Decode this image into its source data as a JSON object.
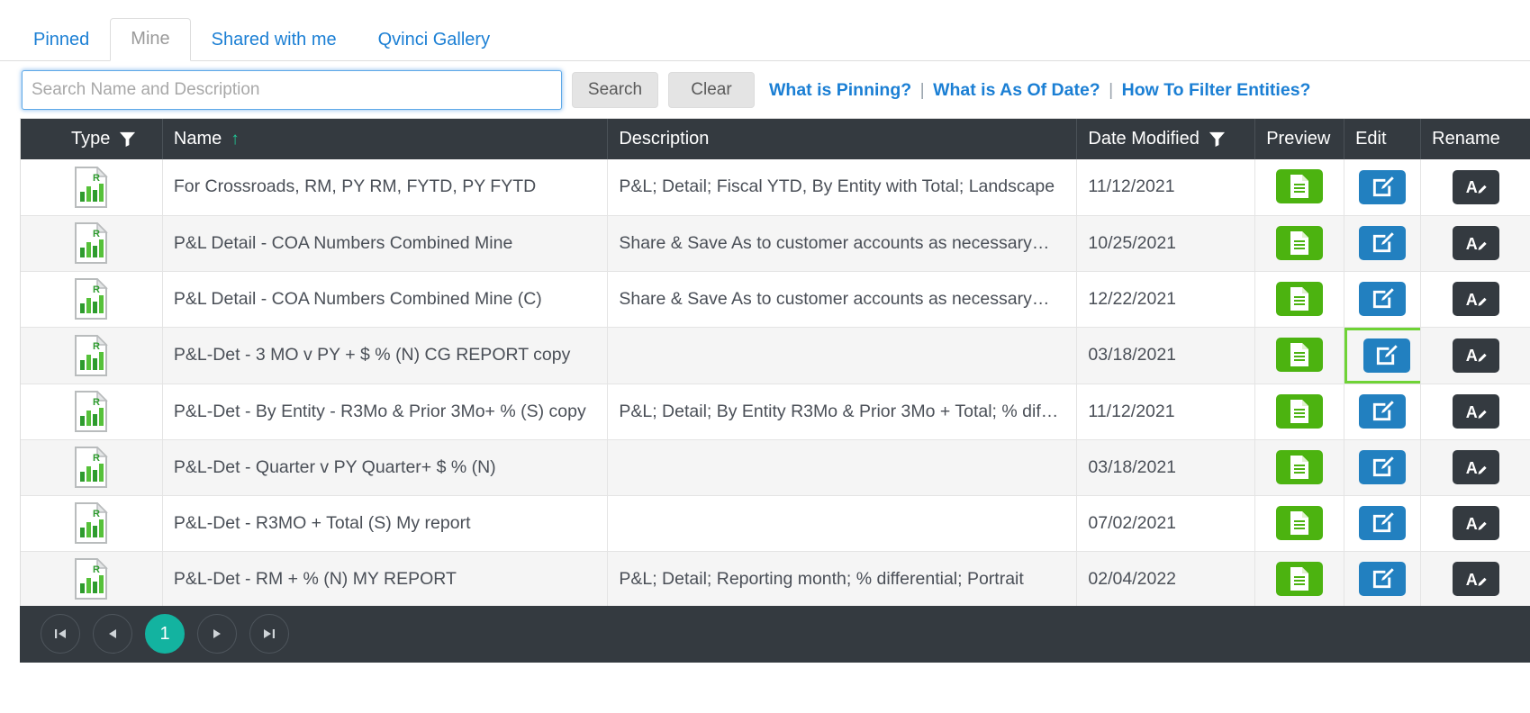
{
  "tabs": [
    {
      "label": "Pinned",
      "active": false
    },
    {
      "label": "Mine",
      "active": true
    },
    {
      "label": "Shared with me",
      "active": false
    },
    {
      "label": "Qvinci Gallery",
      "active": false
    }
  ],
  "search": {
    "value": "",
    "placeholder": "Search Name and Description",
    "search_button": "Search",
    "clear_button": "Clear"
  },
  "help_links": [
    {
      "label": "What is Pinning?"
    },
    {
      "label": "What is As Of Date?"
    },
    {
      "label": "How To Filter Entities?"
    }
  ],
  "link_separator": "|",
  "grid": {
    "columns": {
      "type": "Type",
      "name": "Name",
      "description": "Description",
      "date_modified": "Date Modified",
      "preview": "Preview",
      "edit": "Edit",
      "rename": "Rename"
    },
    "sort": {
      "column": "Name",
      "direction": "ascending",
      "glyph": "↑"
    },
    "filters": [
      "type-filter-icon",
      "date-modified-filter-icon"
    ],
    "rows": [
      {
        "type_icon": "report-chart-document-icon",
        "name": "For Crossroads, RM, PY RM, FYTD, PY FYTD",
        "description": "P&L; Detail; Fiscal YTD, By Entity with Total; Landscape",
        "date_modified": "11/12/2021",
        "preview_icon": "preview-document-icon",
        "edit_icon": "edit-pencil-icon",
        "rename_icon": "rename-a-pencil-icon",
        "edit_focused": false
      },
      {
        "type_icon": "report-chart-document-icon",
        "name": "P&L Detail - COA Numbers Combined Mine",
        "description": "Share & Save As to customer accounts as necessary…",
        "date_modified": "10/25/2021",
        "preview_icon": "preview-document-icon",
        "edit_icon": "edit-pencil-icon",
        "rename_icon": "rename-a-pencil-icon",
        "edit_focused": false
      },
      {
        "type_icon": "report-chart-document-icon",
        "name": "P&L Detail - COA Numbers Combined Mine (C)",
        "description": "Share & Save As to customer accounts as necessary…",
        "date_modified": "12/22/2021",
        "preview_icon": "preview-document-icon",
        "edit_icon": "edit-pencil-icon",
        "rename_icon": "rename-a-pencil-icon",
        "edit_focused": false
      },
      {
        "type_icon": "report-chart-document-icon",
        "name": "P&L-Det - 3 MO v PY + $ % (N) CG REPORT copy",
        "description": "",
        "date_modified": "03/18/2021",
        "preview_icon": "preview-document-icon",
        "edit_icon": "edit-pencil-icon",
        "rename_icon": "rename-a-pencil-icon",
        "edit_focused": true
      },
      {
        "type_icon": "report-chart-document-icon",
        "name": "P&L-Det - By Entity - R3Mo & Prior 3Mo+ % (S) copy",
        "description": "P&L; Detail; By Entity R3Mo & Prior 3Mo + Total; % dif…",
        "date_modified": "11/12/2021",
        "preview_icon": "preview-document-icon",
        "edit_icon": "edit-pencil-icon",
        "rename_icon": "rename-a-pencil-icon",
        "edit_focused": false
      },
      {
        "type_icon": "report-chart-document-icon",
        "name": "P&L-Det - Quarter v PY Quarter+ $ % (N)",
        "description": "",
        "date_modified": "03/18/2021",
        "preview_icon": "preview-document-icon",
        "edit_icon": "edit-pencil-icon",
        "rename_icon": "rename-a-pencil-icon",
        "edit_focused": false
      },
      {
        "type_icon": "report-chart-document-icon",
        "name": "P&L-Det - R3MO + Total (S) My report",
        "description": "",
        "date_modified": "07/02/2021",
        "preview_icon": "preview-document-icon",
        "edit_icon": "edit-pencil-icon",
        "rename_icon": "rename-a-pencil-icon",
        "edit_focused": false
      },
      {
        "type_icon": "report-chart-document-icon",
        "name": "P&L-Det - RM + % (N) MY REPORT",
        "description": "P&L; Detail; Reporting month; % differential; Portrait",
        "date_modified": "02/04/2022",
        "preview_icon": "preview-document-icon",
        "edit_icon": "edit-pencil-icon",
        "rename_icon": "rename-a-pencil-icon",
        "edit_focused": false
      }
    ]
  },
  "pager": {
    "first": "⏮",
    "prev": "◀",
    "next": "▶",
    "last": "⏭",
    "pages": [
      "1"
    ],
    "current_page": "1"
  },
  "colors": {
    "tab_link": "#1b7fd4",
    "header_bg": "#343a40",
    "sort_arrow": "#20c997",
    "preview_green": "#4cb310",
    "edit_blue": "#2280c0",
    "rename_dark": "#343a40",
    "focus_ring": "#6fd336",
    "pager_active": "#13b3a0"
  }
}
